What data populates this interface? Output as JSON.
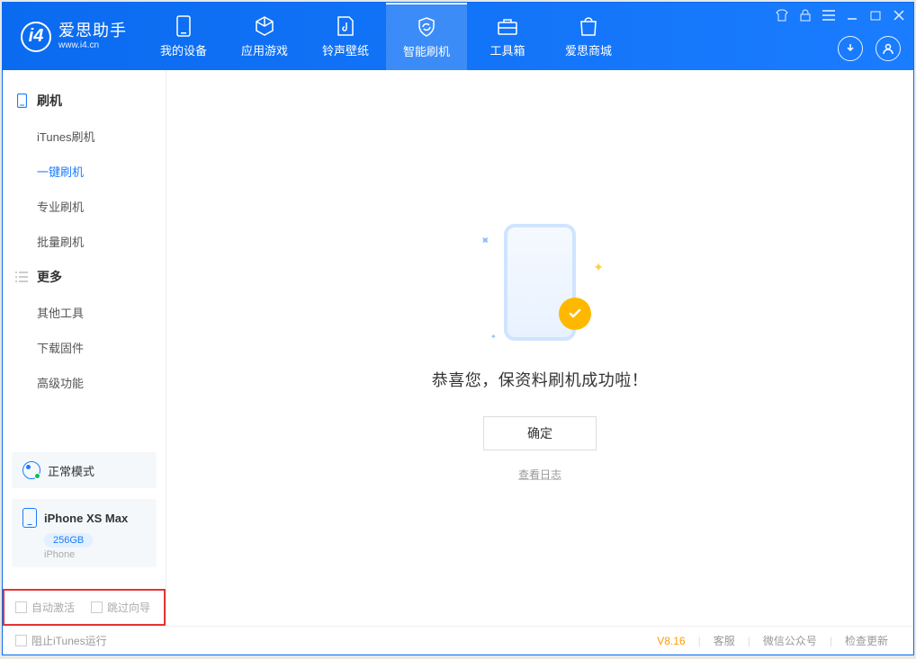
{
  "app": {
    "name": "爱思助手",
    "url": "www.i4.cn"
  },
  "nav": {
    "items": [
      {
        "label": "我的设备"
      },
      {
        "label": "应用游戏"
      },
      {
        "label": "铃声壁纸"
      },
      {
        "label": "智能刷机"
      },
      {
        "label": "工具箱"
      },
      {
        "label": "爱思商城"
      }
    ],
    "activeIndex": 3
  },
  "sidebar": {
    "group1": {
      "title": "刷机",
      "items": [
        "iTunes刷机",
        "一键刷机",
        "专业刷机",
        "批量刷机"
      ],
      "activeIndex": 1
    },
    "group2": {
      "title": "更多",
      "items": [
        "其他工具",
        "下载固件",
        "高级功能"
      ]
    },
    "mode": {
      "label": "正常模式"
    },
    "device": {
      "name": "iPhone XS Max",
      "storage": "256GB",
      "type": "iPhone"
    },
    "options": {
      "autoActivate": "自动激活",
      "skipGuide": "跳过向导"
    }
  },
  "main": {
    "successText": "恭喜您，保资料刷机成功啦！",
    "okButton": "确定",
    "logLink": "查看日志"
  },
  "footer": {
    "stopItunes": "阻止iTunes运行",
    "version": "V8.16",
    "links": [
      "客服",
      "微信公众号",
      "检查更新"
    ]
  }
}
